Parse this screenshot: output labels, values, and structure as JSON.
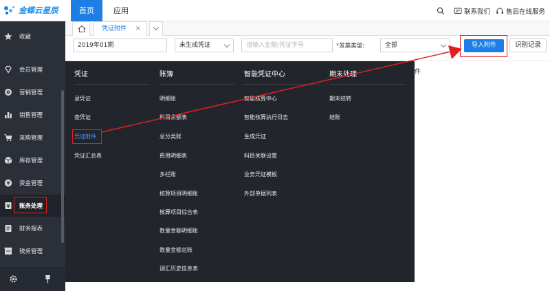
{
  "app": {
    "brand": "金蝶云星辰"
  },
  "topnav": {
    "home": "首页",
    "apps": "应用"
  },
  "topright": {
    "contact": "联系我们",
    "service": "售后在线服务"
  },
  "sidebar": {
    "items": [
      {
        "label": "收藏",
        "icon": "star-icon"
      },
      {
        "label": "会员管理",
        "icon": "diamond-icon"
      },
      {
        "label": "营销管理",
        "icon": "target-icon"
      },
      {
        "label": "销售管理",
        "icon": "bar-chart-icon"
      },
      {
        "label": "采购管理",
        "icon": "cart-icon"
      },
      {
        "label": "库存管理",
        "icon": "box-icon"
      },
      {
        "label": "资金管理",
        "icon": "coin-icon"
      },
      {
        "label": "账务处理",
        "icon": "ledger-icon"
      },
      {
        "label": "财务报表",
        "icon": "report-icon"
      },
      {
        "label": "税务管理",
        "icon": "tax-icon"
      }
    ],
    "bottom": {
      "settings_icon": "gear-icon",
      "pin_icon": "pin-icon"
    }
  },
  "tabs": {
    "open": "凭证附件"
  },
  "filters": {
    "period": "2019年01期",
    "voucher_status": "未生成凭证",
    "search_placeholder": "请输入金额/凭证字号",
    "type_label": "发票类型:",
    "type_value": "全部",
    "import_button": "导入附件",
    "history_button": "识别记录"
  },
  "peek_text": "件",
  "menu": {
    "columns": [
      {
        "title": "凭证",
        "items": [
          "录凭证",
          "查凭证",
          "凭证附件",
          "凭证汇总表"
        ]
      },
      {
        "title": "账簿",
        "items": [
          "明细账",
          "科目余额表",
          "总分类账",
          "费用明细表",
          "多栏账",
          "核算项目明细账",
          "核算项目综合表",
          "数量金额明细账",
          "数量金额总账",
          "调汇历史信息表"
        ]
      },
      {
        "title": "智能凭证中心",
        "items": [
          "智能核算中心",
          "智能核算执行日志",
          "生成凭证",
          "科目关联设置",
          "业务凭证模板",
          "外部单据列表"
        ]
      },
      {
        "title": "期末处理",
        "items": [
          "期末结转",
          "结账"
        ]
      }
    ]
  },
  "colors": {
    "accent": "#1f7ee6",
    "sidebar_bg": "#2b2f38",
    "menu_bg": "#22252c",
    "highlight": "#e02020"
  }
}
